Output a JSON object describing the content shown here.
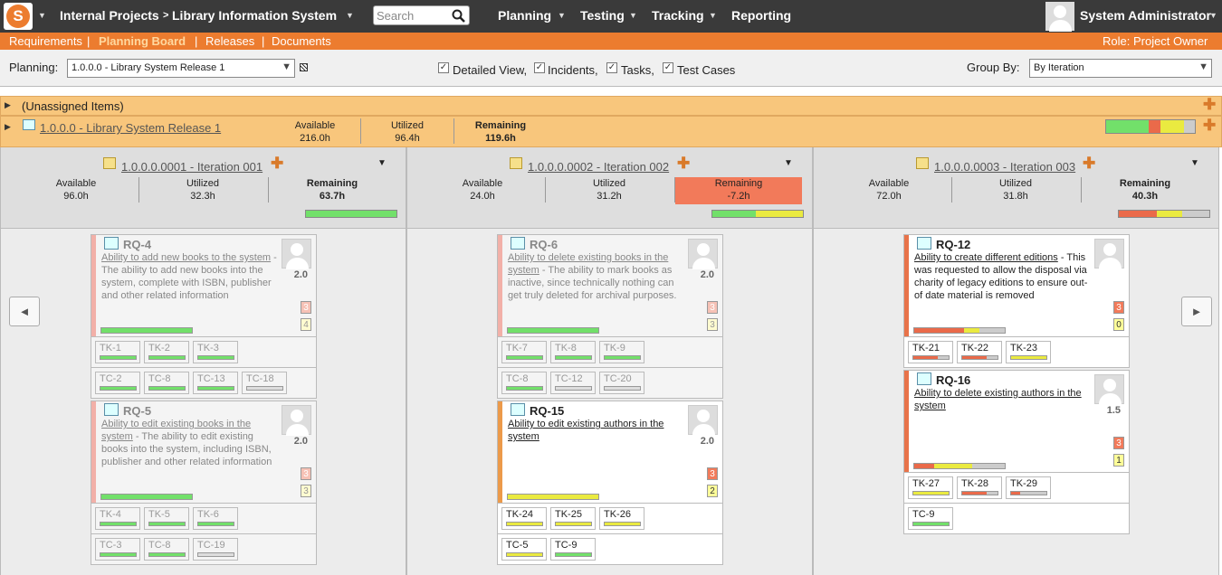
{
  "topbar": {
    "logo_letter": "S",
    "project_menu": "Internal Projects",
    "project_sep": ">",
    "project_current": "Library Information System",
    "search_placeholder": "Search",
    "nav": [
      "Planning",
      "Testing",
      "Tracking",
      "Reporting"
    ],
    "user": "System Administrator"
  },
  "subnav": {
    "items": [
      "Requirements",
      "Planning Board",
      "Releases",
      "Documents"
    ],
    "active": "Planning Board",
    "role": "Role: Project Owner"
  },
  "controls": {
    "planning_label": "Planning:",
    "planning_value": "1.0.0.0 - Library System Release 1",
    "detailed_view": "Detailed View,",
    "incidents": "Incidents,",
    "tasks": "Tasks,",
    "test_cases": "Test Cases",
    "group_by_label": "Group By:",
    "group_by_value": "By Iteration"
  },
  "unassigned": "(Unassigned Items)",
  "release": {
    "title": "1.0.0.0 - Library System Release 1",
    "available_label": "Available",
    "available": "216.0h",
    "utilized_label": "Utilized",
    "utilized": "96.4h",
    "remaining_label": "Remaining",
    "remaining": "119.6h",
    "progress": {
      "green": 0.48,
      "red": 0.13,
      "yellow": 0.27,
      "gray": 0.12
    }
  },
  "iterations": [
    {
      "title": "1.0.0.0.0001 - Iteration 001",
      "available_label": "Available",
      "available": "96.0h",
      "utilized_label": "Utilized",
      "utilized": "32.3h",
      "remaining_label": "Remaining",
      "remaining": "63.7h",
      "over": false,
      "progress": {
        "green": 1.0,
        "red": 0,
        "yellow": 0,
        "gray": 0
      },
      "cards": [
        {
          "id": "RQ-4",
          "dim": true,
          "link": "Ability to add new books to the system",
          "text": " - The ability to add new books into the system, complete with ISBN, publisher and other related information",
          "est": "2.0",
          "b1": "3",
          "b2": "4",
          "bar": {
            "green": 1.0,
            "red": 0,
            "yellow": 0
          },
          "tasks": [
            {
              "id": "TK-1",
              "c": "g"
            },
            {
              "id": "TK-2",
              "c": "g"
            },
            {
              "id": "TK-3",
              "c": "g"
            }
          ],
          "tests": [
            {
              "id": "TC-2",
              "c": "g"
            },
            {
              "id": "TC-8",
              "c": "g"
            },
            {
              "id": "TC-13",
              "c": "g"
            },
            {
              "id": "TC-18",
              "c": "lt"
            }
          ]
        },
        {
          "id": "RQ-5",
          "dim": true,
          "link": "Ability to edit existing books in the system",
          "text": " - The ability to edit existing books into the system, including ISBN, publisher and other related information",
          "est": "2.0",
          "b1": "3",
          "b2": "3",
          "bar": {
            "green": 1.0,
            "red": 0,
            "yellow": 0
          },
          "tasks": [
            {
              "id": "TK-4",
              "c": "g"
            },
            {
              "id": "TK-5",
              "c": "g"
            },
            {
              "id": "TK-6",
              "c": "g"
            }
          ],
          "tests": [
            {
              "id": "TC-3",
              "c": "g"
            },
            {
              "id": "TC-8",
              "c": "g"
            },
            {
              "id": "TC-19",
              "c": "lt"
            }
          ]
        }
      ]
    },
    {
      "title": "1.0.0.0.0002 - Iteration 002",
      "available_label": "Available",
      "available": "24.0h",
      "utilized_label": "Utilized",
      "utilized": "31.2h",
      "remaining_label": "Remaining",
      "remaining": "-7.2h",
      "over": true,
      "progress": {
        "green": 0.48,
        "red": 0,
        "yellow": 0.52,
        "gray": 0
      },
      "cards": [
        {
          "id": "RQ-6",
          "dim": true,
          "link": "Ability to delete existing books in the system",
          "text": " - The ability to mark books as inactive, since technically nothing can get truly deleted for archival purposes.",
          "est": "2.0",
          "b1": "3",
          "b2": "3",
          "bar": {
            "green": 1.0,
            "red": 0,
            "yellow": 0
          },
          "tasks": [
            {
              "id": "TK-7",
              "c": "g"
            },
            {
              "id": "TK-8",
              "c": "g"
            },
            {
              "id": "TK-9",
              "c": "g"
            }
          ],
          "tests": [
            {
              "id": "TC-8",
              "c": "g"
            },
            {
              "id": "TC-12",
              "c": "lt"
            },
            {
              "id": "TC-20",
              "c": "lt"
            }
          ]
        },
        {
          "id": "RQ-15",
          "dim": false,
          "link": "Ability to edit existing authors in the system",
          "text": "",
          "est": "2.0",
          "b1": "3",
          "b2": "2",
          "bar": {
            "green": 0,
            "red": 0,
            "yellow": 1.0
          },
          "tasks": [
            {
              "id": "TK-24",
              "c": "y"
            },
            {
              "id": "TK-25",
              "c": "y"
            },
            {
              "id": "TK-26",
              "c": "y"
            }
          ],
          "tests": [
            {
              "id": "TC-5",
              "c": "y"
            },
            {
              "id": "TC-9",
              "c": "g"
            }
          ]
        }
      ]
    },
    {
      "title": "1.0.0.0.0003 - Iteration 003",
      "available_label": "Available",
      "available": "72.0h",
      "utilized_label": "Utilized",
      "utilized": "31.8h",
      "remaining_label": "Remaining",
      "remaining": "40.3h",
      "over": false,
      "progress": {
        "green": 0,
        "red": 0.42,
        "yellow": 0.28,
        "gray": 0.3
      },
      "cards": [
        {
          "id": "RQ-12",
          "dim": false,
          "link": "Ability to create different editions",
          "text": " - This was requested to allow the disposal via charity of legacy editions to ensure out-of date material is removed",
          "est": "",
          "b1": "3",
          "b2": "0",
          "bar": {
            "green": 0,
            "red": 0.55,
            "yellow": 0.17
          },
          "tasks": [
            {
              "id": "TK-21",
              "c": "rg"
            },
            {
              "id": "TK-22",
              "c": "rg"
            },
            {
              "id": "TK-23",
              "c": "y"
            }
          ],
          "tests": []
        },
        {
          "id": "RQ-16",
          "dim": false,
          "link": "Ability to delete existing authors in the system",
          "text": "",
          "est": "1.5",
          "b1": "3",
          "b2": "1",
          "bar": {
            "green": 0,
            "red": 0.22,
            "yellow": 0.42
          },
          "tasks": [
            {
              "id": "TK-27",
              "c": "y"
            },
            {
              "id": "TK-28",
              "c": "rg"
            },
            {
              "id": "TK-29",
              "c": "rg2"
            }
          ],
          "tests": [
            {
              "id": "TC-9",
              "c": "g"
            }
          ]
        }
      ]
    }
  ],
  "nav_prev": "◄",
  "nav_next": "►"
}
